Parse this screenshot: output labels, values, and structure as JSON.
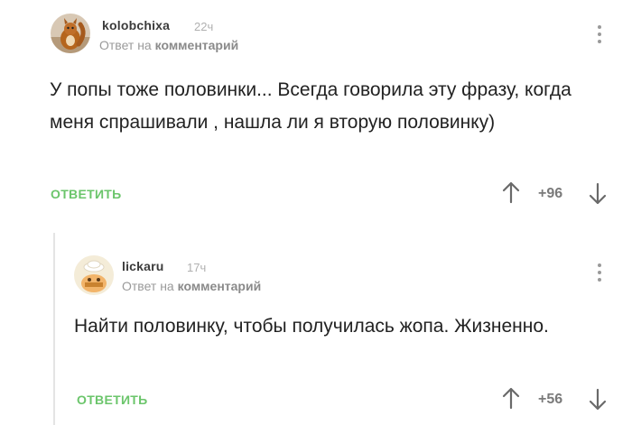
{
  "comments": [
    {
      "username": "kolobchixa",
      "time": "22ч",
      "reply_prefix": "Ответ на",
      "reply_target": "комментарий",
      "text": "У попы тоже половинки... Всегда говорила эту фразу, когда меня спрашивали , нашла ли я вторую половинку)",
      "reply_label": "ОТВЕТИТЬ",
      "score": "+96"
    },
    {
      "username": "lickaru",
      "time": "17ч",
      "reply_prefix": "Ответ на",
      "reply_target": "комментарий",
      "text": "Найти половинку, чтобы получилась жопа. Жизненно.",
      "reply_label": "ОТВЕТИТЬ",
      "score": "+56"
    }
  ],
  "colors": {
    "reply_link": "#6bc56b",
    "text": "#222222",
    "meta": "#9a9a9a",
    "score": "#7a7a7a"
  },
  "icons": [
    "squirrel-avatar",
    "cartoon-avatar",
    "more-vertical-icon",
    "arrow-up-icon",
    "arrow-down-icon"
  ]
}
